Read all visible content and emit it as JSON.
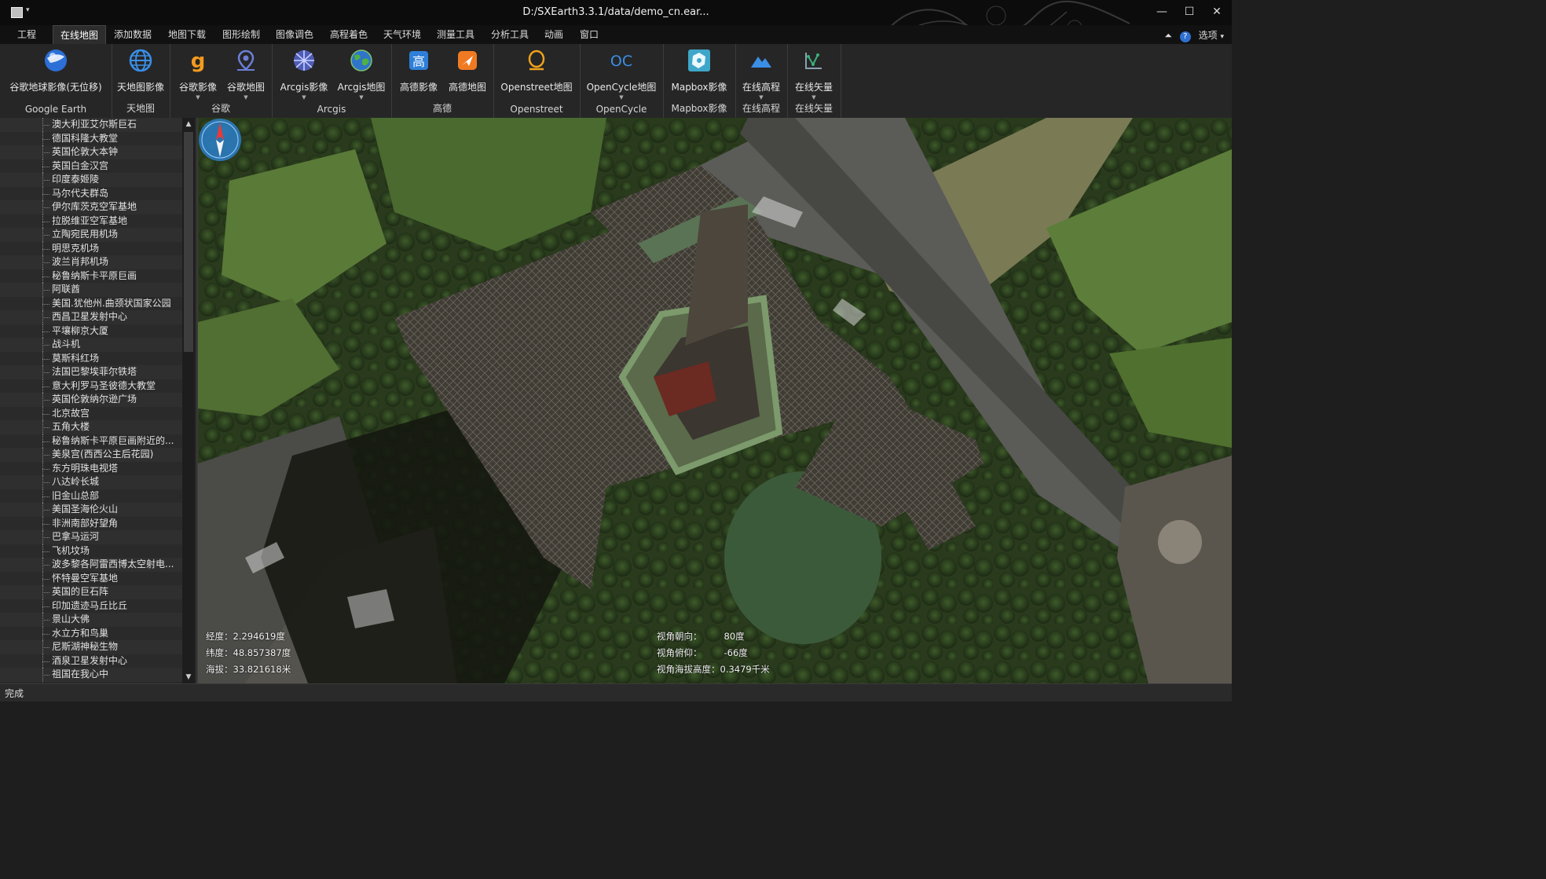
{
  "window": {
    "title": "D:/SXEarth3.3.1/data/demo_cn.ear...",
    "minimize": "—",
    "maximize": "☐",
    "close": "✕"
  },
  "menubar": {
    "items": [
      "工程",
      "在线地图",
      "添加数据",
      "地图下载",
      "图形绘制",
      "图像调色",
      "高程着色",
      "天气环境",
      "测量工具",
      "分析工具",
      "动画",
      "窗口"
    ],
    "active": "在线地图",
    "options": "选项"
  },
  "ribbon": {
    "groups": [
      {
        "label": "Google Earth",
        "buttons": [
          {
            "label": "谷歌地球影像(无位移)",
            "icon": "google-earth-globe-icon"
          }
        ]
      },
      {
        "label": "天地图",
        "buttons": [
          {
            "label": "天地图影像",
            "icon": "tianditu-globe-icon"
          }
        ]
      },
      {
        "label": "谷歌",
        "buttons": [
          {
            "label": "谷歌影像",
            "icon": "google-g-icon"
          },
          {
            "label": "谷歌地图",
            "icon": "google-maps-pin-icon"
          }
        ]
      },
      {
        "label": "Arcgis",
        "buttons": [
          {
            "label": "Arcgis影像",
            "icon": "arcgis-globe-icon"
          },
          {
            "label": "Arcgis地图",
            "icon": "arcgis-world-icon"
          }
        ]
      },
      {
        "label": "高德",
        "buttons": [
          {
            "label": "高德影像",
            "icon": "gaode-image-icon"
          },
          {
            "label": "高德地图",
            "icon": "gaode-map-icon"
          }
        ]
      },
      {
        "label": "Openstreet",
        "buttons": [
          {
            "label": "Openstreet地图",
            "icon": "openstreetmap-icon"
          }
        ]
      },
      {
        "label": "OpenCycle",
        "buttons": [
          {
            "label": "OpenCycle地图",
            "icon": "opencycle-icon"
          }
        ]
      },
      {
        "label": "Mapbox影像",
        "buttons": [
          {
            "label": "Mapbox影像",
            "icon": "mapbox-icon"
          }
        ]
      },
      {
        "label": "在线高程",
        "buttons": [
          {
            "label": "在线高程",
            "icon": "mountain-icon"
          }
        ]
      },
      {
        "label": "在线矢量",
        "buttons": [
          {
            "label": "在线矢量",
            "icon": "vector-icon"
          }
        ]
      }
    ]
  },
  "sidebar": {
    "items": [
      "澳大利亚艾尔斯巨石",
      "德国科隆大教堂",
      "英国伦敦大本钟",
      "英国白金汉宫",
      "印度泰姬陵",
      "马尔代夫群岛",
      "伊尔库茨克空军基地",
      "拉脱维亚空军基地",
      "立陶宛民用机场",
      "明思克机场",
      "波兰肖邦机场",
      "秘鲁纳斯卡平原巨画",
      "阿联酋",
      "美国.犹他州.曲颈状国家公园",
      "西昌卫星发射中心",
      "平壤柳京大厦",
      "战斗机",
      "莫斯科红场",
      "法国巴黎埃菲尔铁塔",
      "意大利罗马圣彼德大教堂",
      "英国伦敦纳尔逊广场",
      "北京故宫",
      "五角大楼",
      "秘鲁纳斯卡平原巨画附近的...",
      "美泉宫(西西公主后花园)",
      "东方明珠电视塔",
      "八达岭长城",
      "旧金山总部",
      "美国圣海伦火山",
      "非洲南部好望角",
      "巴拿马运河",
      "飞机坟场",
      "波多黎各阿雷西博太空射电...",
      "怀特曼空军基地",
      "英国的巨石阵",
      "印加遗迹马丘比丘",
      "景山大佛",
      "水立方和鸟巢",
      "尼斯湖神秘生物",
      "酒泉卫星发射中心",
      "祖国在我心中"
    ]
  },
  "map": {
    "info_left": [
      "经度：2.294619度",
      "纬度：48.857387度",
      "海拔：33.821618米"
    ],
    "info_right": [
      {
        "label": "视角朝向：",
        "value": "80度"
      },
      {
        "label": "视角俯仰：",
        "value": "-66度"
      },
      {
        "label": "视角海拔高度：",
        "value": "0.3479千米"
      }
    ]
  },
  "status": {
    "text": "完成"
  },
  "colors": {
    "accent": "#3a8ee6",
    "background": "#1e1e1e",
    "ribbon": "#262626"
  }
}
